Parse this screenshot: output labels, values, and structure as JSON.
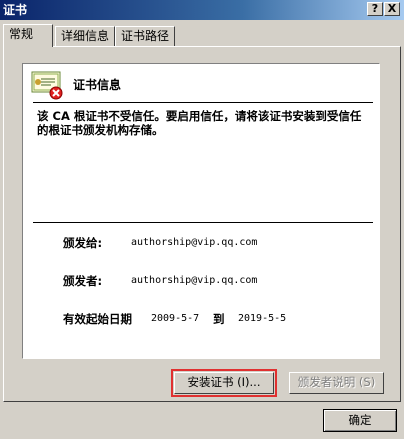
{
  "window": {
    "title": "证书",
    "help_glyph": "?",
    "close_glyph": "X"
  },
  "tabs": [
    {
      "label": "常规"
    },
    {
      "label": "详细信息"
    },
    {
      "label": "证书路径"
    }
  ],
  "info": {
    "title": "证书信息",
    "warning": "该 CA 根证书不受信任。要启用信任，请将该证书安装到受信任的根证书颁发机构存储。",
    "issued_to_label": "颁发给:",
    "issued_to_value": "authorship@vip.qq.com",
    "issued_by_label": "颁发者:",
    "issued_by_value": "authorship@vip.qq.com",
    "valid_label": "有效起始日期",
    "valid_from": "2009-5-7",
    "valid_to_label": "到",
    "valid_to": "2019-5-5"
  },
  "buttons": {
    "install": "安装证书 (I)...",
    "issuer_statement": "颁发者说明 (S)",
    "ok": "确定"
  },
  "colors": {
    "titlebar": "#0a246a",
    "error_badge": "#e02020",
    "highlight_outline": "#e03030"
  },
  "icons": {
    "certificate": "certificate-error-icon"
  }
}
